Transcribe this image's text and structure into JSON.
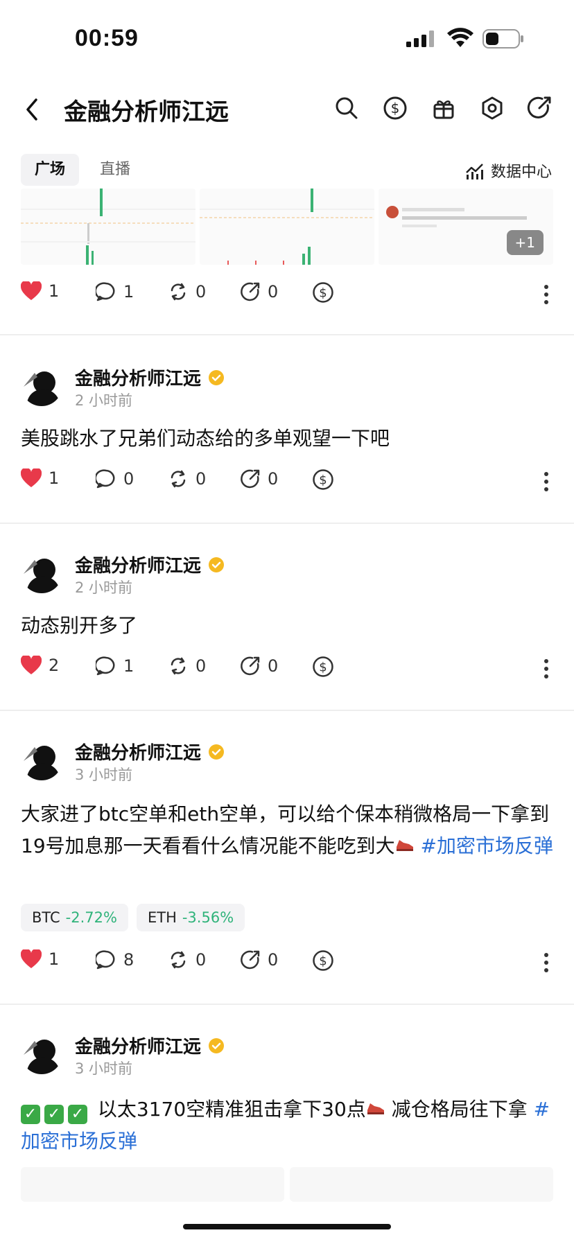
{
  "status": {
    "time": "00:59"
  },
  "header": {
    "title": "金融分析师江远"
  },
  "tabs": [
    {
      "label": "广场"
    },
    {
      "label": "直播"
    }
  ],
  "data_center": {
    "label": "数据中心"
  },
  "top_post": {
    "plus_badge": "+1",
    "stats": {
      "likes": "1",
      "comments": "1",
      "reposts": "0",
      "shares": "0"
    }
  },
  "posts": [
    {
      "author": "金融分析师江远",
      "time": "2 小时前",
      "text": "美股跳水了兄弟们动态给的多单观望一下吧",
      "stats": {
        "likes": "1",
        "comments": "0",
        "reposts": "0",
        "shares": "0"
      }
    },
    {
      "author": "金融分析师江远",
      "time": "2 小时前",
      "text": "动态别开多了",
      "stats": {
        "likes": "2",
        "comments": "1",
        "reposts": "0",
        "shares": "0"
      }
    },
    {
      "author": "金融分析师江远",
      "time": "3 小时前",
      "text_part1": "大家进了btc空单和eth空单，可以给个保本稍微格局一下拿到19号加息那一天看看什么情况能不能吃到大",
      "tag": "#加密市场反弹",
      "coins": [
        {
          "symbol": "BTC",
          "change": "-2.72%"
        },
        {
          "symbol": "ETH",
          "change": "-3.56%"
        }
      ],
      "stats": {
        "likes": "1",
        "comments": "8",
        "reposts": "0",
        "shares": "0"
      }
    },
    {
      "author": "金融分析师江远",
      "time": "3 小时前",
      "text_part1": "以太3170空精准狙击拿下30点",
      "text_part2": "减仓格局往下拿",
      "tag": "#加密市场反弹"
    }
  ],
  "colors": {
    "accent_red": "#e8394a",
    "tag_blue": "#2a6fd6",
    "change_green": "#2fb37a"
  }
}
